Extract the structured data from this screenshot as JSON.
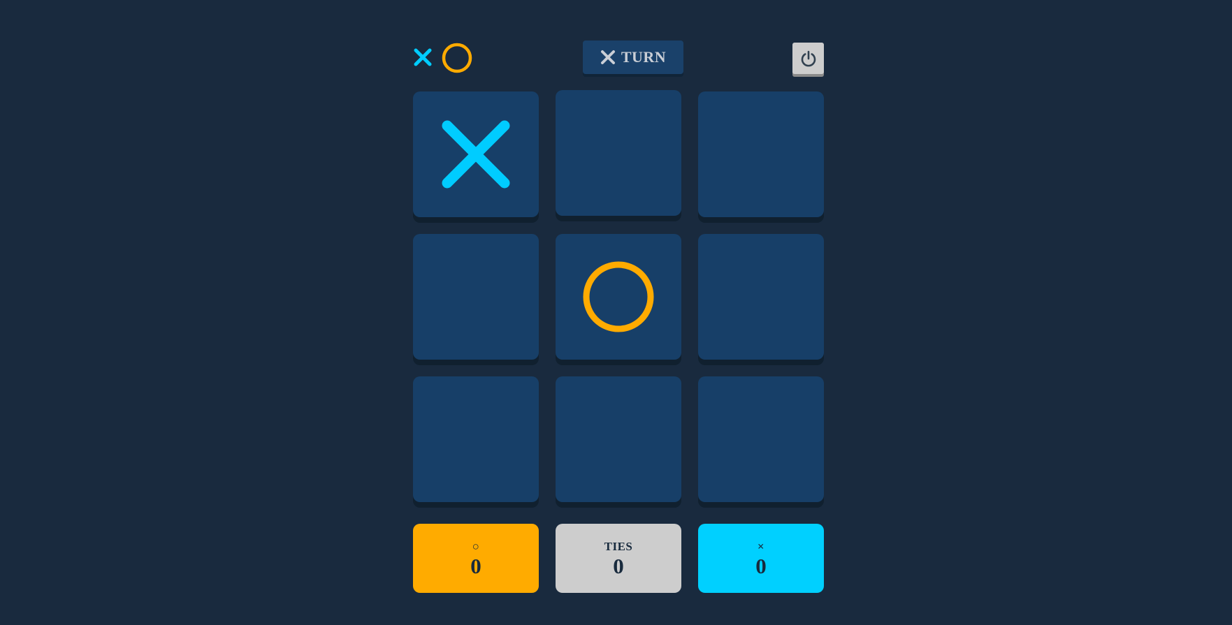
{
  "header": {
    "turn_label": "TURN",
    "current_turn": "X"
  },
  "board": [
    "X",
    "",
    "",
    "",
    "O",
    "",
    "",
    "",
    ""
  ],
  "scores": {
    "o": {
      "label": "○",
      "value": "0",
      "color": "#ffab00"
    },
    "ties": {
      "label": "TIES",
      "value": "0",
      "color": "#cdcdcd"
    },
    "x": {
      "label": "×",
      "value": "0",
      "color": "#00d0ff"
    }
  },
  "colors": {
    "x": "#00ccff",
    "o": "#ffab00",
    "background": "#192a3e",
    "cell": "#173f68"
  },
  "icons": {
    "restart": "power-icon"
  }
}
